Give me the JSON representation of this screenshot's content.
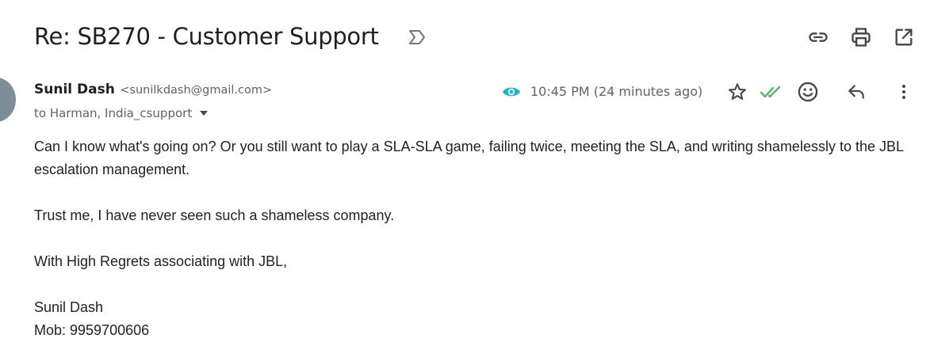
{
  "email": {
    "subject": "Re: SB270 - Customer Support",
    "sender": {
      "name": "Sunil Dash",
      "email": "<sunilkdash@gmail.com>"
    },
    "recipients": "to Harman, India_csupport",
    "timestamp": "10:45 PM (24 minutes ago)",
    "body": {
      "paragraph1": "Can I know what's going on? Or you still want to play a SLA-SLA game, failing twice, meeting the SLA, and writing shamelessly to the JBL escalation management.",
      "paragraph2": "Trust me, I have never seen such a shameless company.",
      "paragraph3": "With High Regrets associating with JBL,",
      "signature_name": "Sunil Dash",
      "signature_phone": "Mob: 9959700606"
    }
  },
  "icons": {
    "subject_label": "label-icon",
    "top_actions": [
      "link-icon",
      "print-icon",
      "open-in-new-window-icon"
    ],
    "header_actions": [
      "star-icon",
      "double-check-icon",
      "emoji-icon",
      "reply-icon",
      "more-vert-icon"
    ],
    "tracking": "eye-icon"
  },
  "colors": {
    "eye_icon": "#12b5cb",
    "double_check": "#5bb974",
    "avatar": "#7b8e99"
  }
}
